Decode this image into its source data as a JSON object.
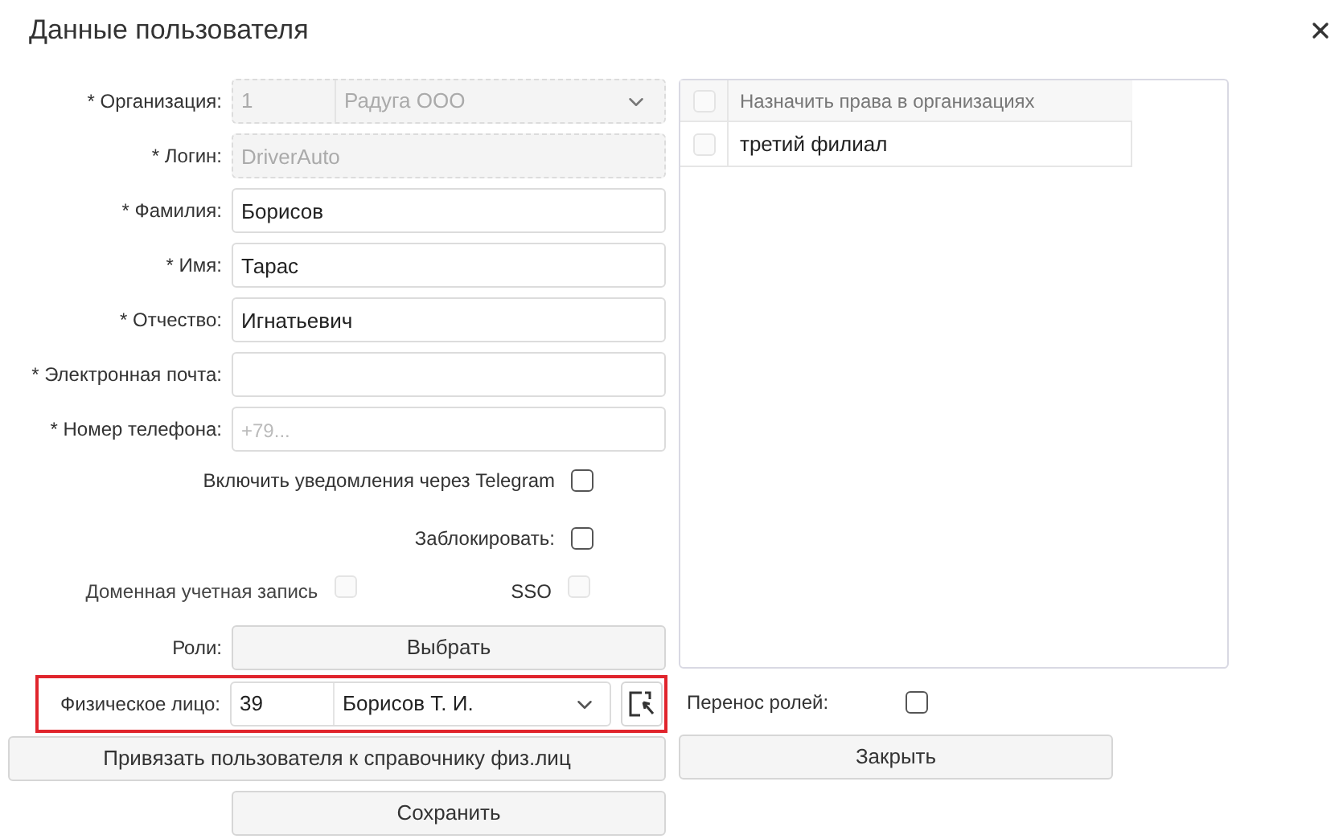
{
  "dialog": {
    "title": "Данные пользователя"
  },
  "fields": [
    {
      "label": "* Организация:",
      "kind": "combo",
      "code": "1",
      "value": "Радуга ООО",
      "disabled": true
    },
    {
      "label": "* Логин:",
      "kind": "text",
      "value": "DriverAuto",
      "disabled": true
    },
    {
      "label": "* Фамилия:",
      "kind": "text",
      "value": "Борисов",
      "disabled": false
    },
    {
      "label": "* Имя:",
      "kind": "text",
      "value": "Тарас",
      "disabled": false
    },
    {
      "label": "* Отчество:",
      "kind": "text",
      "value": "Игнатьевич",
      "disabled": false
    },
    {
      "label": "* Электронная почта:",
      "kind": "text",
      "disabled": false
    },
    {
      "label": "* Номер телефона:",
      "kind": "text",
      "placeholder": "+79...",
      "disabled": false
    }
  ],
  "telegram": {
    "label": "Включить уведомления через Telegram",
    "checked": false
  },
  "block": {
    "label": "Заблокировать:",
    "checked": false
  },
  "domain": {
    "label": "Доменная учетная запись",
    "checked": false,
    "disabled": true
  },
  "sso": {
    "label": "SSO",
    "checked": false,
    "disabled": true
  },
  "roles": {
    "label": "Роли:",
    "button": "Выбрать"
  },
  "person": {
    "label": "Физическое лицо:",
    "code": "39",
    "value": "Борисов Т. И.",
    "highlighted": true
  },
  "bind_button": "Привязать пользователя к справочнику физ.лиц",
  "save_button": "Сохранить",
  "orgs_table": {
    "header": "Назначить права в организациях",
    "header_checked": false,
    "rows": [
      {
        "name": "третий филиал",
        "checked": false
      }
    ]
  },
  "transfer_roles": {
    "label": "Перенос ролей:",
    "checked": false
  },
  "close_button": "Закрыть"
}
